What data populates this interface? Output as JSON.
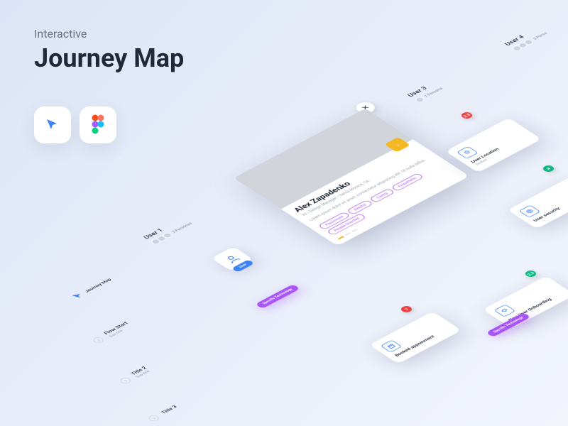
{
  "header": {
    "subtitle": "Interactive",
    "title": "Journey Map"
  },
  "tools": {
    "figjam": "figjam-icon",
    "figma": "figma-icon"
  },
  "profile": {
    "name": "Alex Zapadenko",
    "meta": "30 • Design Manager • Santa Monica, CA.",
    "desc": "Lorem ipsum dolor sit amet, consectetur adipiscing elit. Ut nulla tellus.",
    "tags": [
      "Passionate",
      "Helpful",
      "Caring",
      "Empathetic",
      "People-Oriented"
    ]
  },
  "users": {
    "u1": {
      "label": "User 1",
      "personas": "3 Personas"
    },
    "u3": {
      "label": "User 3",
      "personas": "1 Persona"
    },
    "u4": {
      "label": "User 4",
      "personas": "3 Perso"
    }
  },
  "cards": {
    "location": {
      "title": "User Location",
      "sub": "Verified"
    },
    "security": {
      "title": "User security",
      "sub": ""
    },
    "booked": {
      "title": "Booked appoinment",
      "sub": ""
    },
    "onboarding": {
      "title": "New User Onboarding",
      "sub": ""
    }
  },
  "chips": {
    "tech1": "Specific Technology",
    "tech2": "Specific Technology"
  },
  "node": {
    "user_label": "User"
  },
  "badges": {
    "r23": "2.3",
    "g4": "4",
    "r1": "1",
    "g23": "2.3"
  },
  "flow": {
    "f1": {
      "title": "Flow Start",
      "sub": "Sub-title"
    },
    "f2": {
      "title": "Title 2",
      "sub": "Sub-title"
    },
    "f3": {
      "title": "Title 3",
      "sub": ""
    }
  },
  "app": {
    "name": "Journey Map"
  }
}
